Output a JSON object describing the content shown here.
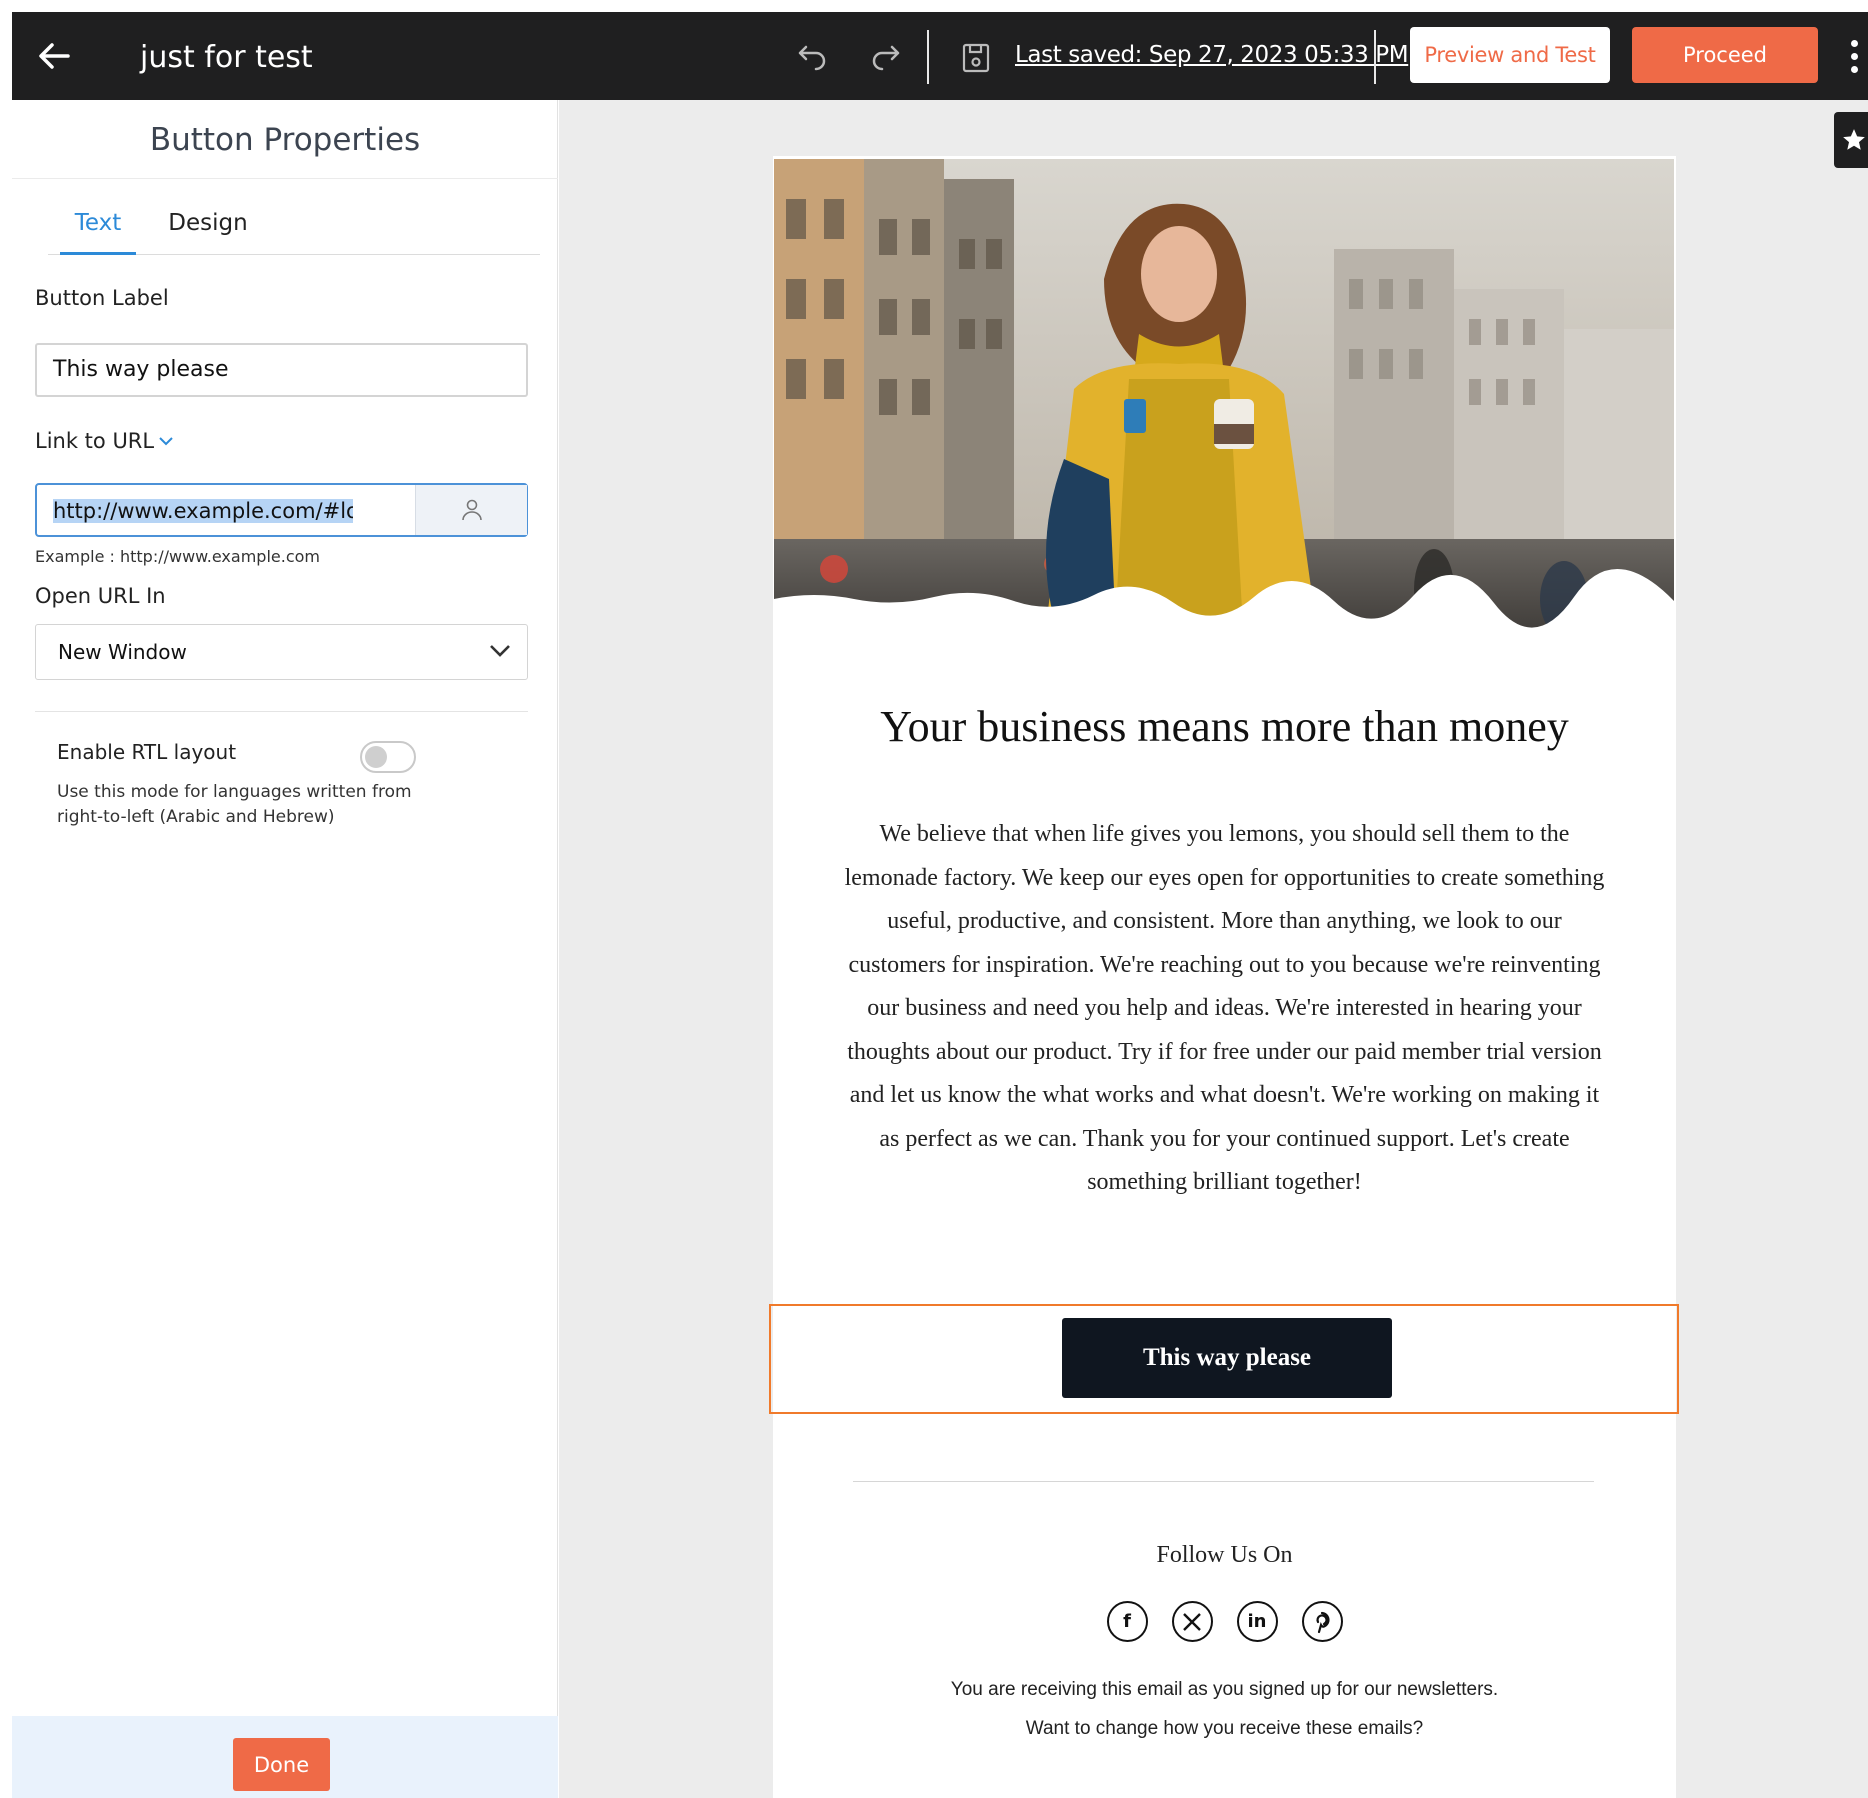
{
  "topbar": {
    "title": "just for test",
    "last_saved": "Last saved: Sep 27, 2023 05:33 PM",
    "preview_label": "Preview and Test",
    "proceed_label": "Proceed",
    "accent_color": "#ef6a47"
  },
  "panel": {
    "title": "Button Properties",
    "tabs": [
      {
        "label": "Text",
        "active": true
      },
      {
        "label": "Design",
        "active": false
      }
    ],
    "button_label_title": "Button Label",
    "button_label_value": "This way please",
    "link_label": "Link to URL",
    "url_value": "http://www.example.com/#loloya",
    "url_hint": "Example : http://www.example.com",
    "open_in_label": "Open URL In",
    "open_in_value": "New Window",
    "rtl_title": "Enable RTL layout",
    "rtl_enabled": false,
    "rtl_desc": "Use this mode for languages written from right-to-left (Arabic and Hebrew)",
    "done_label": "Done"
  },
  "email": {
    "headline": "Your business means more than money",
    "body": "We believe that when life gives you lemons, you should sell them to the lemonade factory. We keep our eyes open for opportunities to create something useful, productive, and consistent. More than anything, we look to our customers for inspiration. We're reaching out to you because we're reinventing our business and need you help and ideas. We're interested in hearing your thoughts about our product. Try if for free under our paid member trial version and let us know the what works and what doesn't. We're working on making it as perfect as we can. Thank you for your continued support. Let's create something brilliant together!",
    "cta_label": "This way please",
    "follow_label": "Follow Us On",
    "socials": [
      "facebook-icon",
      "x-icon",
      "linkedin-icon",
      "pinterest-icon"
    ],
    "notice_1": "You are receiving this email as you signed up for our newsletters.",
    "notice_2": "Want to change how you receive these emails?"
  }
}
